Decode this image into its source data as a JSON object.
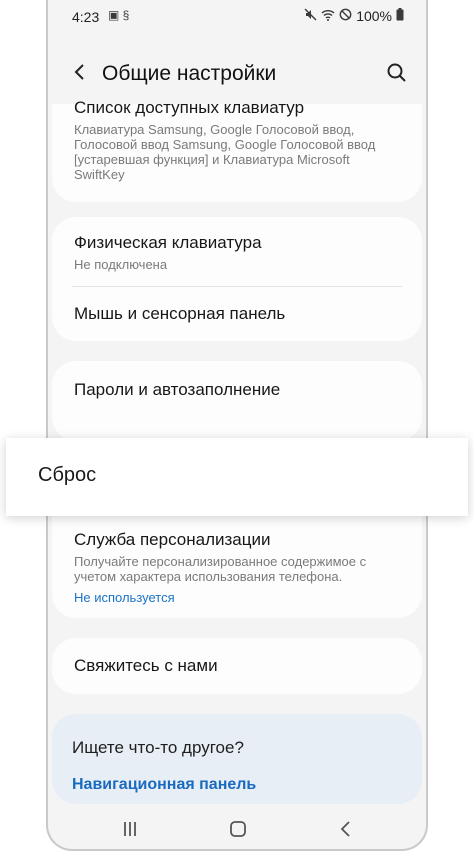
{
  "status": {
    "time": "4:23",
    "left_icons": "▣ §",
    "battery": "100%"
  },
  "header": {
    "title": "Общие настройки"
  },
  "items": {
    "keyboards_title": "Список доступных клавиатур",
    "keyboards_sub": "Клавиатура Samsung, Google Голосовой ввод, Голосовой ввод Samsung, Google Голосовой ввод [устаревшая функция] и Клавиатура Microsoft SwiftKey",
    "physical_title": "Физическая клавиатура",
    "physical_sub": "Не подключена",
    "mouse_title": "Мышь и сенсорная панель",
    "passwords_title": "Пароли и автозаполнение",
    "reset": "Сброс",
    "personal_title": "Служба персонализации",
    "personal_sub": "Получайте персонализированное содержимое с учетом характера использования телефона.",
    "personal_link": "Не используется",
    "contact_title": "Свяжитесь с нами"
  },
  "suggest": {
    "question": "Ищете что-то другое?",
    "link": "Навигационная панель"
  }
}
